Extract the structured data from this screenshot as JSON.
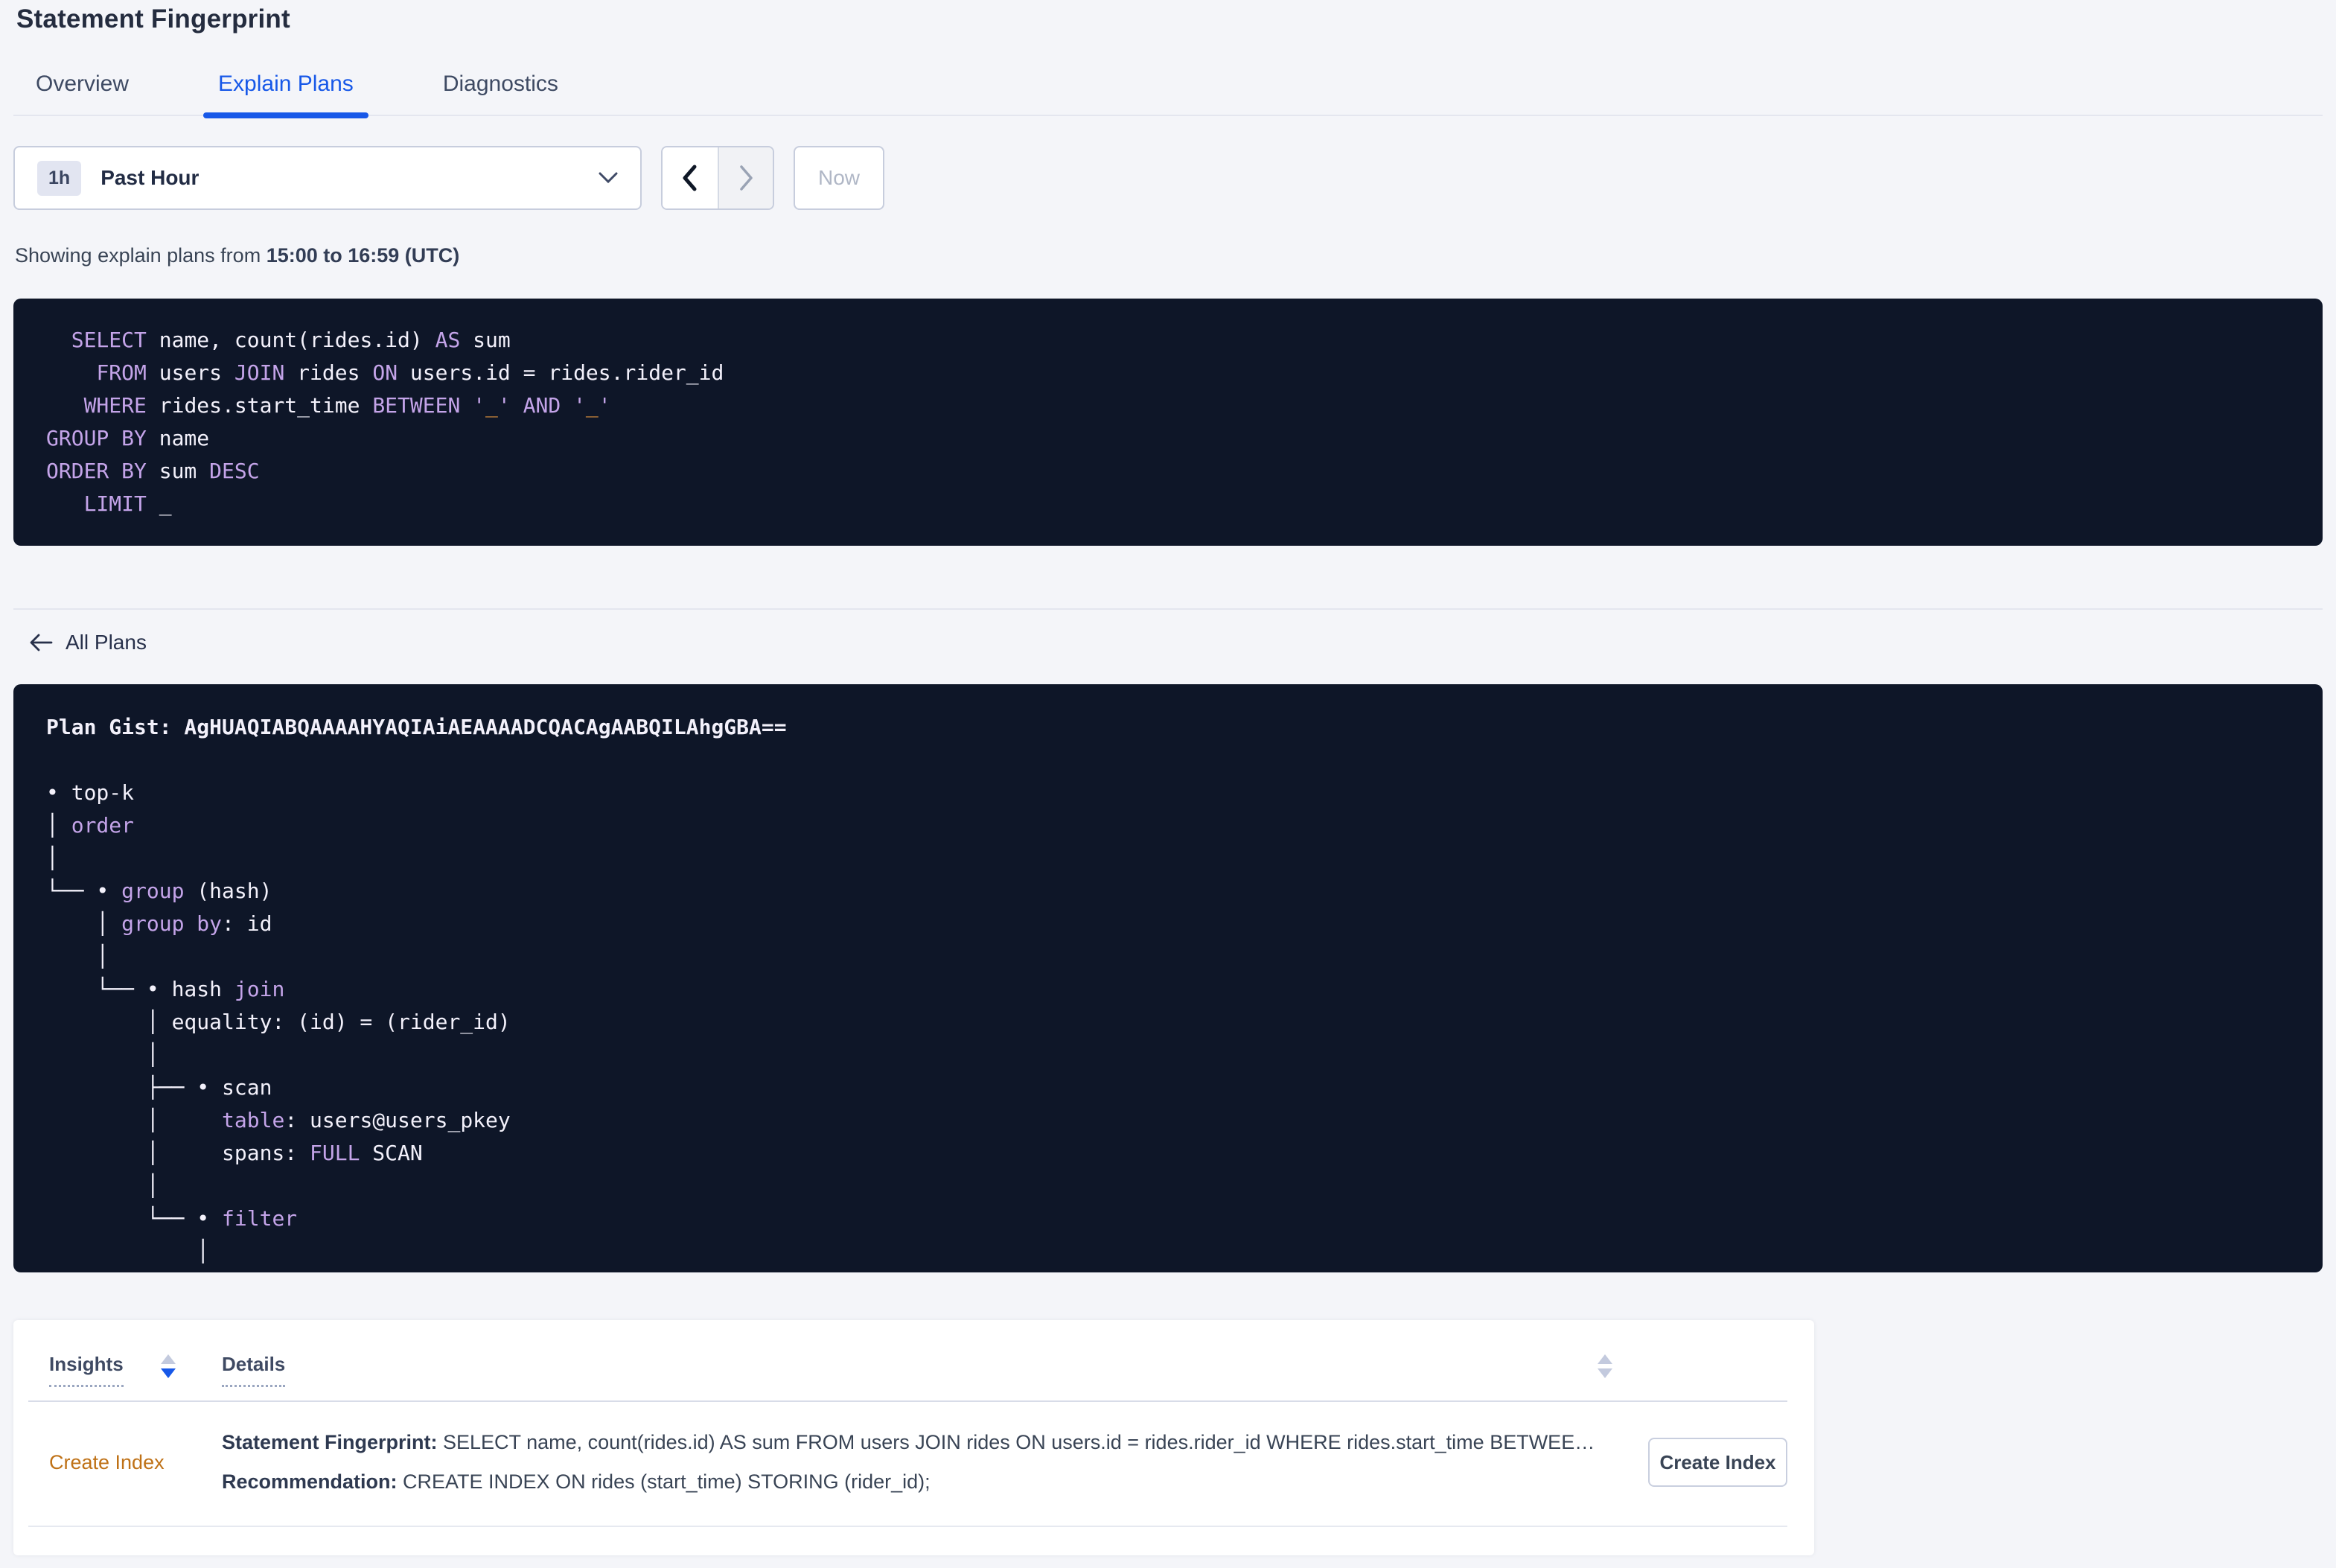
{
  "header": {
    "title": "Statement Fingerprint"
  },
  "tabs": [
    {
      "label": "Overview",
      "active": false
    },
    {
      "label": "Explain Plans",
      "active": true
    },
    {
      "label": "Diagnostics",
      "active": false
    }
  ],
  "time_picker": {
    "duration_badge": "1h",
    "selected_label": "Past Hour",
    "now_button": "Now"
  },
  "showing_line": {
    "prefix": "Showing explain plans from ",
    "range_bold": "15:00 to 16:59 (UTC)"
  },
  "back_link": {
    "label": "All Plans"
  },
  "sql_block": {
    "lines": [
      [
        [
          "p",
          "  "
        ],
        [
          "k",
          "SELECT"
        ],
        [
          "p",
          " name, count(rides.id) "
        ],
        [
          "k",
          "AS"
        ],
        [
          "p",
          " sum"
        ]
      ],
      [
        [
          "p",
          "    "
        ],
        [
          "k",
          "FROM"
        ],
        [
          "p",
          " users "
        ],
        [
          "k",
          "JOIN"
        ],
        [
          "p",
          " rides "
        ],
        [
          "k",
          "ON"
        ],
        [
          "p",
          " users.id = rides.rider_id"
        ]
      ],
      [
        [
          "p",
          "   "
        ],
        [
          "k",
          "WHERE"
        ],
        [
          "p",
          " rides.start_time "
        ],
        [
          "k",
          "BETWEEN"
        ],
        [
          "p",
          " "
        ],
        [
          "k",
          "'"
        ],
        [
          "o",
          "_"
        ],
        [
          "k",
          "'"
        ],
        [
          "p",
          " "
        ],
        [
          "k",
          "AND"
        ],
        [
          "p",
          " "
        ],
        [
          "k",
          "'"
        ],
        [
          "o",
          "_"
        ],
        [
          "k",
          "'"
        ]
      ],
      [
        [
          "k",
          "GROUP BY"
        ],
        [
          "p",
          " name"
        ]
      ],
      [
        [
          "k",
          "ORDER BY"
        ],
        [
          "p",
          " sum "
        ],
        [
          "k",
          "DESC"
        ]
      ],
      [
        [
          "p",
          "   "
        ],
        [
          "k",
          "LIMIT"
        ],
        [
          "p",
          " _"
        ]
      ]
    ]
  },
  "plan_block": {
    "lines": [
      [
        [
          "b",
          "Plan Gist: AgHUAQIABQAAAAHYAQIAiAEAAAADCQACAgAABQILAhgGBA=="
        ]
      ],
      [],
      [
        [
          "p",
          "• top-k"
        ]
      ],
      [
        [
          "p",
          "│ "
        ],
        [
          "k",
          "order"
        ]
      ],
      [
        [
          "p",
          "│"
        ]
      ],
      [
        [
          "p",
          "└── • "
        ],
        [
          "k",
          "group"
        ],
        [
          "p",
          " (hash)"
        ]
      ],
      [
        [
          "p",
          "    │ "
        ],
        [
          "k",
          "group by"
        ],
        [
          "p",
          ": id"
        ]
      ],
      [
        [
          "p",
          "    │"
        ]
      ],
      [
        [
          "p",
          "    └── • hash "
        ],
        [
          "k",
          "join"
        ]
      ],
      [
        [
          "p",
          "        │ equality: (id) = (rider_id)"
        ]
      ],
      [
        [
          "p",
          "        │"
        ]
      ],
      [
        [
          "p",
          "        ├── • scan"
        ]
      ],
      [
        [
          "p",
          "        │     "
        ],
        [
          "k",
          "table"
        ],
        [
          "p",
          ": users@users_pkey"
        ]
      ],
      [
        [
          "p",
          "        │     spans: "
        ],
        [
          "k",
          "FULL"
        ],
        [
          "p",
          " SCAN"
        ]
      ],
      [
        [
          "p",
          "        │"
        ]
      ],
      [
        [
          "p",
          "        └── • "
        ],
        [
          "k",
          "filter"
        ]
      ],
      [
        [
          "p",
          "            │"
        ]
      ]
    ]
  },
  "insights": {
    "col_insights": "Insights",
    "col_details": "Details",
    "rows": [
      {
        "insight_link": "Create Index",
        "fingerprint_label": "Statement Fingerprint:",
        "fingerprint_text": " SELECT name, count(rides.id) AS sum FROM users JOIN rides ON users.id = rides.rider_id WHERE rides.start_time BETWEEN '_…",
        "recommendation_label": "Recommendation:",
        "recommendation_text": " CREATE INDEX ON rides (start_time) STORING (rider_id);",
        "action_button": "Create Index"
      }
    ]
  },
  "colors": {
    "accent_blue": "#1758e8",
    "keyword_purple": "#c4a4e9",
    "placeholder_orange": "#e0923d",
    "insight_link_orange": "#bf7116",
    "code_background": "#0e1628",
    "page_background": "#f4f5f9"
  }
}
